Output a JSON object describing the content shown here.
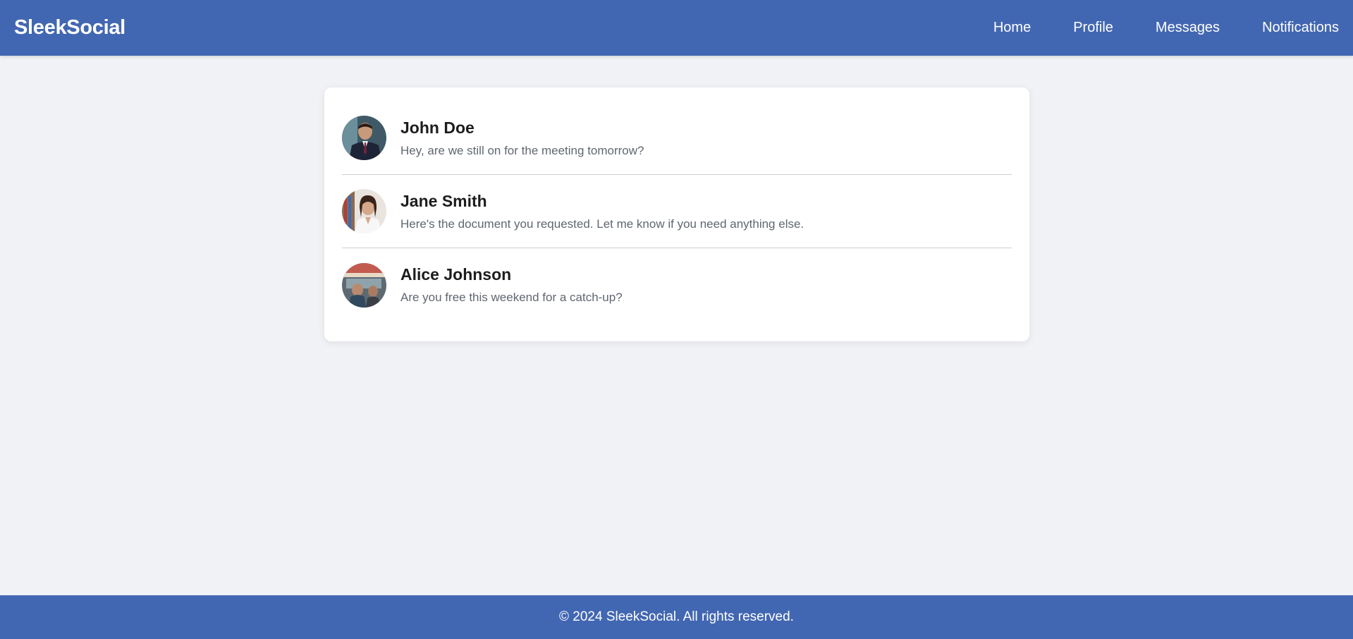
{
  "brand": "SleekSocial",
  "nav": {
    "items": [
      {
        "label": "Home"
      },
      {
        "label": "Profile"
      },
      {
        "label": "Messages"
      },
      {
        "label": "Notifications"
      }
    ]
  },
  "messages": [
    {
      "name": "John Doe",
      "text": "Hey, are we still on for the meeting tomorrow?"
    },
    {
      "name": "Jane Smith",
      "text": "Here's the document you requested. Let me know if you need anything else."
    },
    {
      "name": "Alice Johnson",
      "text": "Are you free this weekend for a catch-up?"
    }
  ],
  "footer": {
    "text": "© 2024 SleekSocial. All rights reserved."
  },
  "colors": {
    "header_bg": "#4267b2",
    "page_bg": "#f0f2f5",
    "card_bg": "#ffffff",
    "name_text": "#1d1d1f",
    "message_text": "#606770"
  }
}
